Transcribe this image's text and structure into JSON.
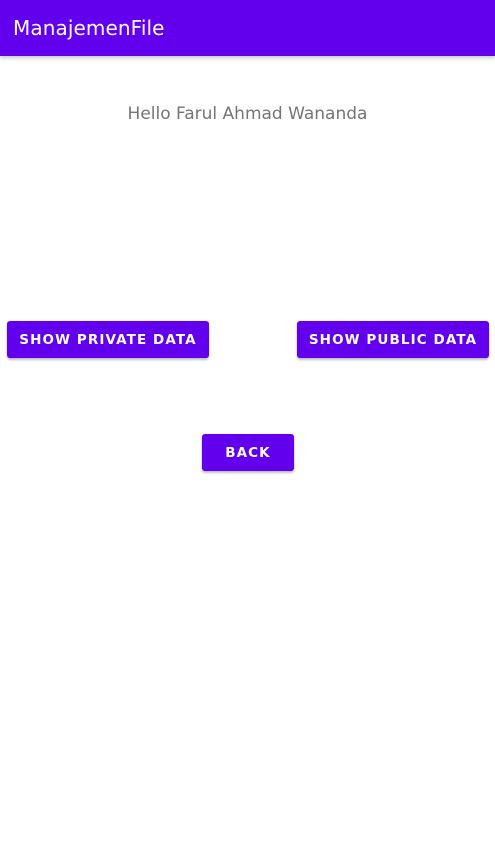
{
  "app_bar": {
    "title": "ManajemenFile"
  },
  "main": {
    "greeting": "Hello Farul Ahmad Wananda",
    "show_private_label": "SHOW PRIVATE DATA",
    "show_public_label": "SHOW PUBLIC DATA",
    "back_label": "BACK"
  },
  "colors": {
    "primary": "#6200ee",
    "on_primary": "#ffffff",
    "greeting_text": "#757575",
    "background": "#ffffff"
  }
}
